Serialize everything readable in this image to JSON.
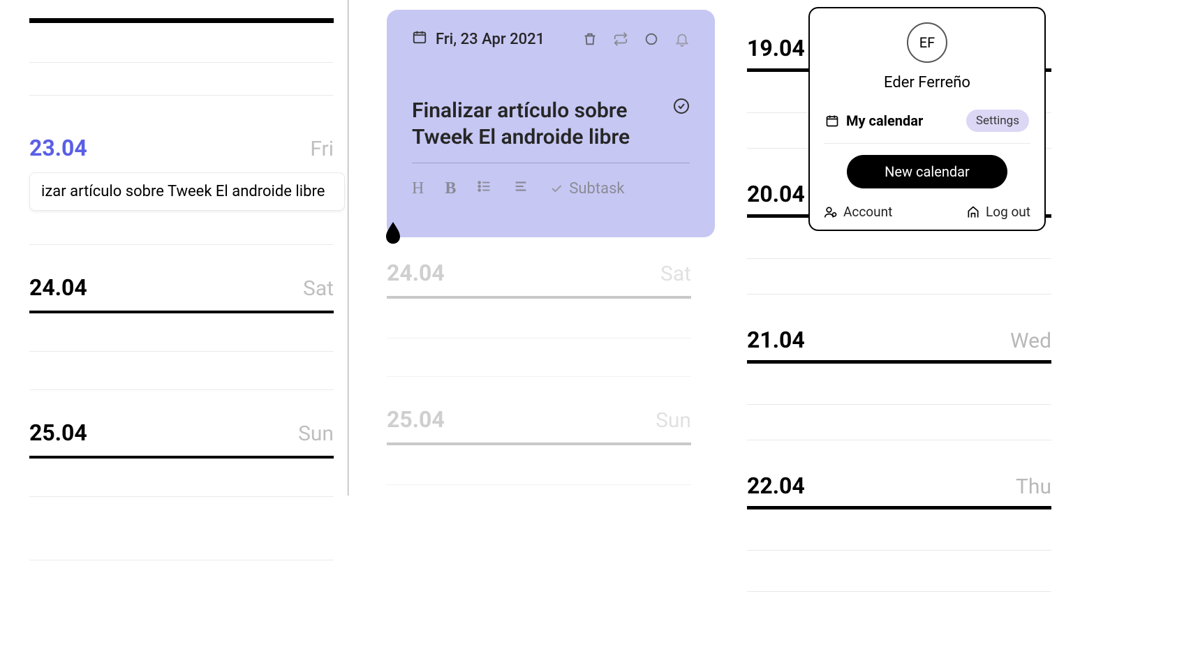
{
  "left": {
    "days": [
      {
        "date": "23.04",
        "name": "Fri",
        "active": true,
        "task": "izar artículo sobre Tweek El androide libre"
      },
      {
        "date": "24.04",
        "name": "Sat"
      },
      {
        "date": "25.04",
        "name": "Sun"
      }
    ]
  },
  "editor": {
    "date_label": "Fri, 23 Apr 2021",
    "title": "Finalizar artículo sobre Tweek El androide libre",
    "subtask_label": "Subtask"
  },
  "mid_days": [
    {
      "date": "24.04",
      "name": "Sat"
    },
    {
      "date": "25.04",
      "name": "Sun"
    }
  ],
  "right_days": [
    {
      "date": "19.04",
      "name": ""
    },
    {
      "date": "20.04",
      "name": ""
    },
    {
      "date": "21.04",
      "name": "Wed"
    },
    {
      "date": "22.04",
      "name": "Thu"
    }
  ],
  "profile": {
    "initials": "EF",
    "name": "Eder Ferreño",
    "calendar_label": "My calendar",
    "settings": "Settings",
    "new_calendar": "New calendar",
    "account": "Account",
    "logout": "Log out"
  }
}
